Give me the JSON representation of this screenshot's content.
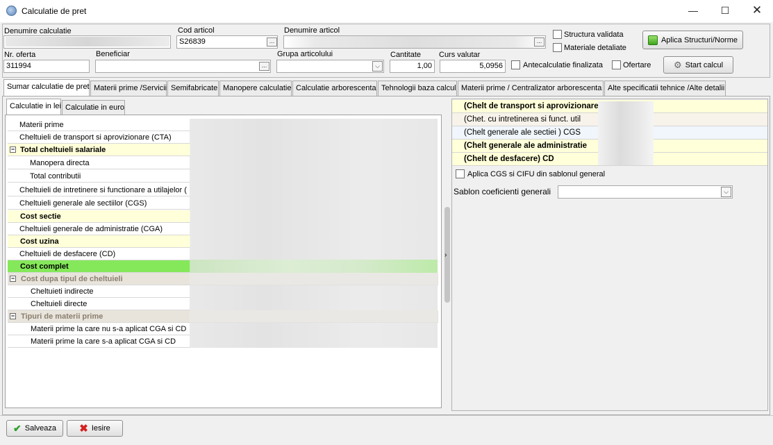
{
  "window": {
    "title": "Calculatie de pret"
  },
  "header": {
    "denumire_calculatie_label": "Denumire calculatie",
    "cod_articol_label": "Cod articol",
    "cod_articol_value": "S26839",
    "denumire_articol_label": "Denumire articol",
    "nr_oferta_label": "Nr. oferta",
    "nr_oferta_value": "311994",
    "beneficiar_label": "Beneficiar",
    "grupa_articolului_label": "Grupa articolului",
    "cantitate_label": "Cantitate",
    "cantitate_value": "1,00",
    "curs_valutar_label": "Curs valutar",
    "curs_valutar_value": "5,0956",
    "structura_validata": "Structura validata",
    "materiale_detaliate": "Materiale detaliate",
    "antecalculatie_finalizata": "Antecalculatie finalizata",
    "ofertare": "Ofertare",
    "aplica_button": "Aplica Structuri/Norme",
    "start_button": "Start calcul",
    "ellipsis": "..."
  },
  "tabs": [
    "Sumar calculatie de pret",
    "Materii prime /Servicii",
    "Semifabricate",
    "Manopere calculatie",
    "Calculatie arborescenta",
    "Tehnologii baza calcul",
    "Materii prime / Centralizator arborescenta",
    "Alte specificatii tehnice /Alte detalii"
  ],
  "subtabs": [
    "Calculatie in lei",
    "Calculatie in euro"
  ],
  "grid_rows": [
    "Materii prime",
    "Cheltuieli de transport si aprovizionare (CTA)",
    "Total cheltuieli salariale",
    "Manopera directa",
    "Total contributii",
    "Cheltuieli de intretinere si functionare a utilajelor (",
    "Cheltuieli generale ale sectiilor (CGS)",
    "Cost sectie",
    "Cheltuieli generale de administratie (CGA)",
    "Cost uzina",
    "Cheltuieli de desfacere (CD)",
    "Cost complet",
    "Cost dupa tipul de cheltuieli",
    "Cheltuieti indirecte",
    "Cheltuieli directe",
    "Tipuri de materii prime",
    "Materii prime la care nu s-a aplicat CGA si CD",
    "Materii prime la care s-a aplicat CGA si CD"
  ],
  "right_rows": [
    "(Chelt de transport si aprovizionare)",
    "(Chet. cu intretinerea si funct. util",
    "(Chelt generale ale sectiei ) CGS",
    "(Chelt generale ale administratie",
    "(Chelt de desfacere) CD"
  ],
  "aplica_cgs_label": "Aplica CGS si CIFU din sablonul general",
  "sablon_label": "Sablon coeficienti generali",
  "footer": {
    "save": "Salveaza",
    "exit": "Iesire"
  },
  "colors": {
    "yellow_row": "#ffffd9",
    "green_row": "#85e85a",
    "group_row": "#e8e4dc"
  }
}
